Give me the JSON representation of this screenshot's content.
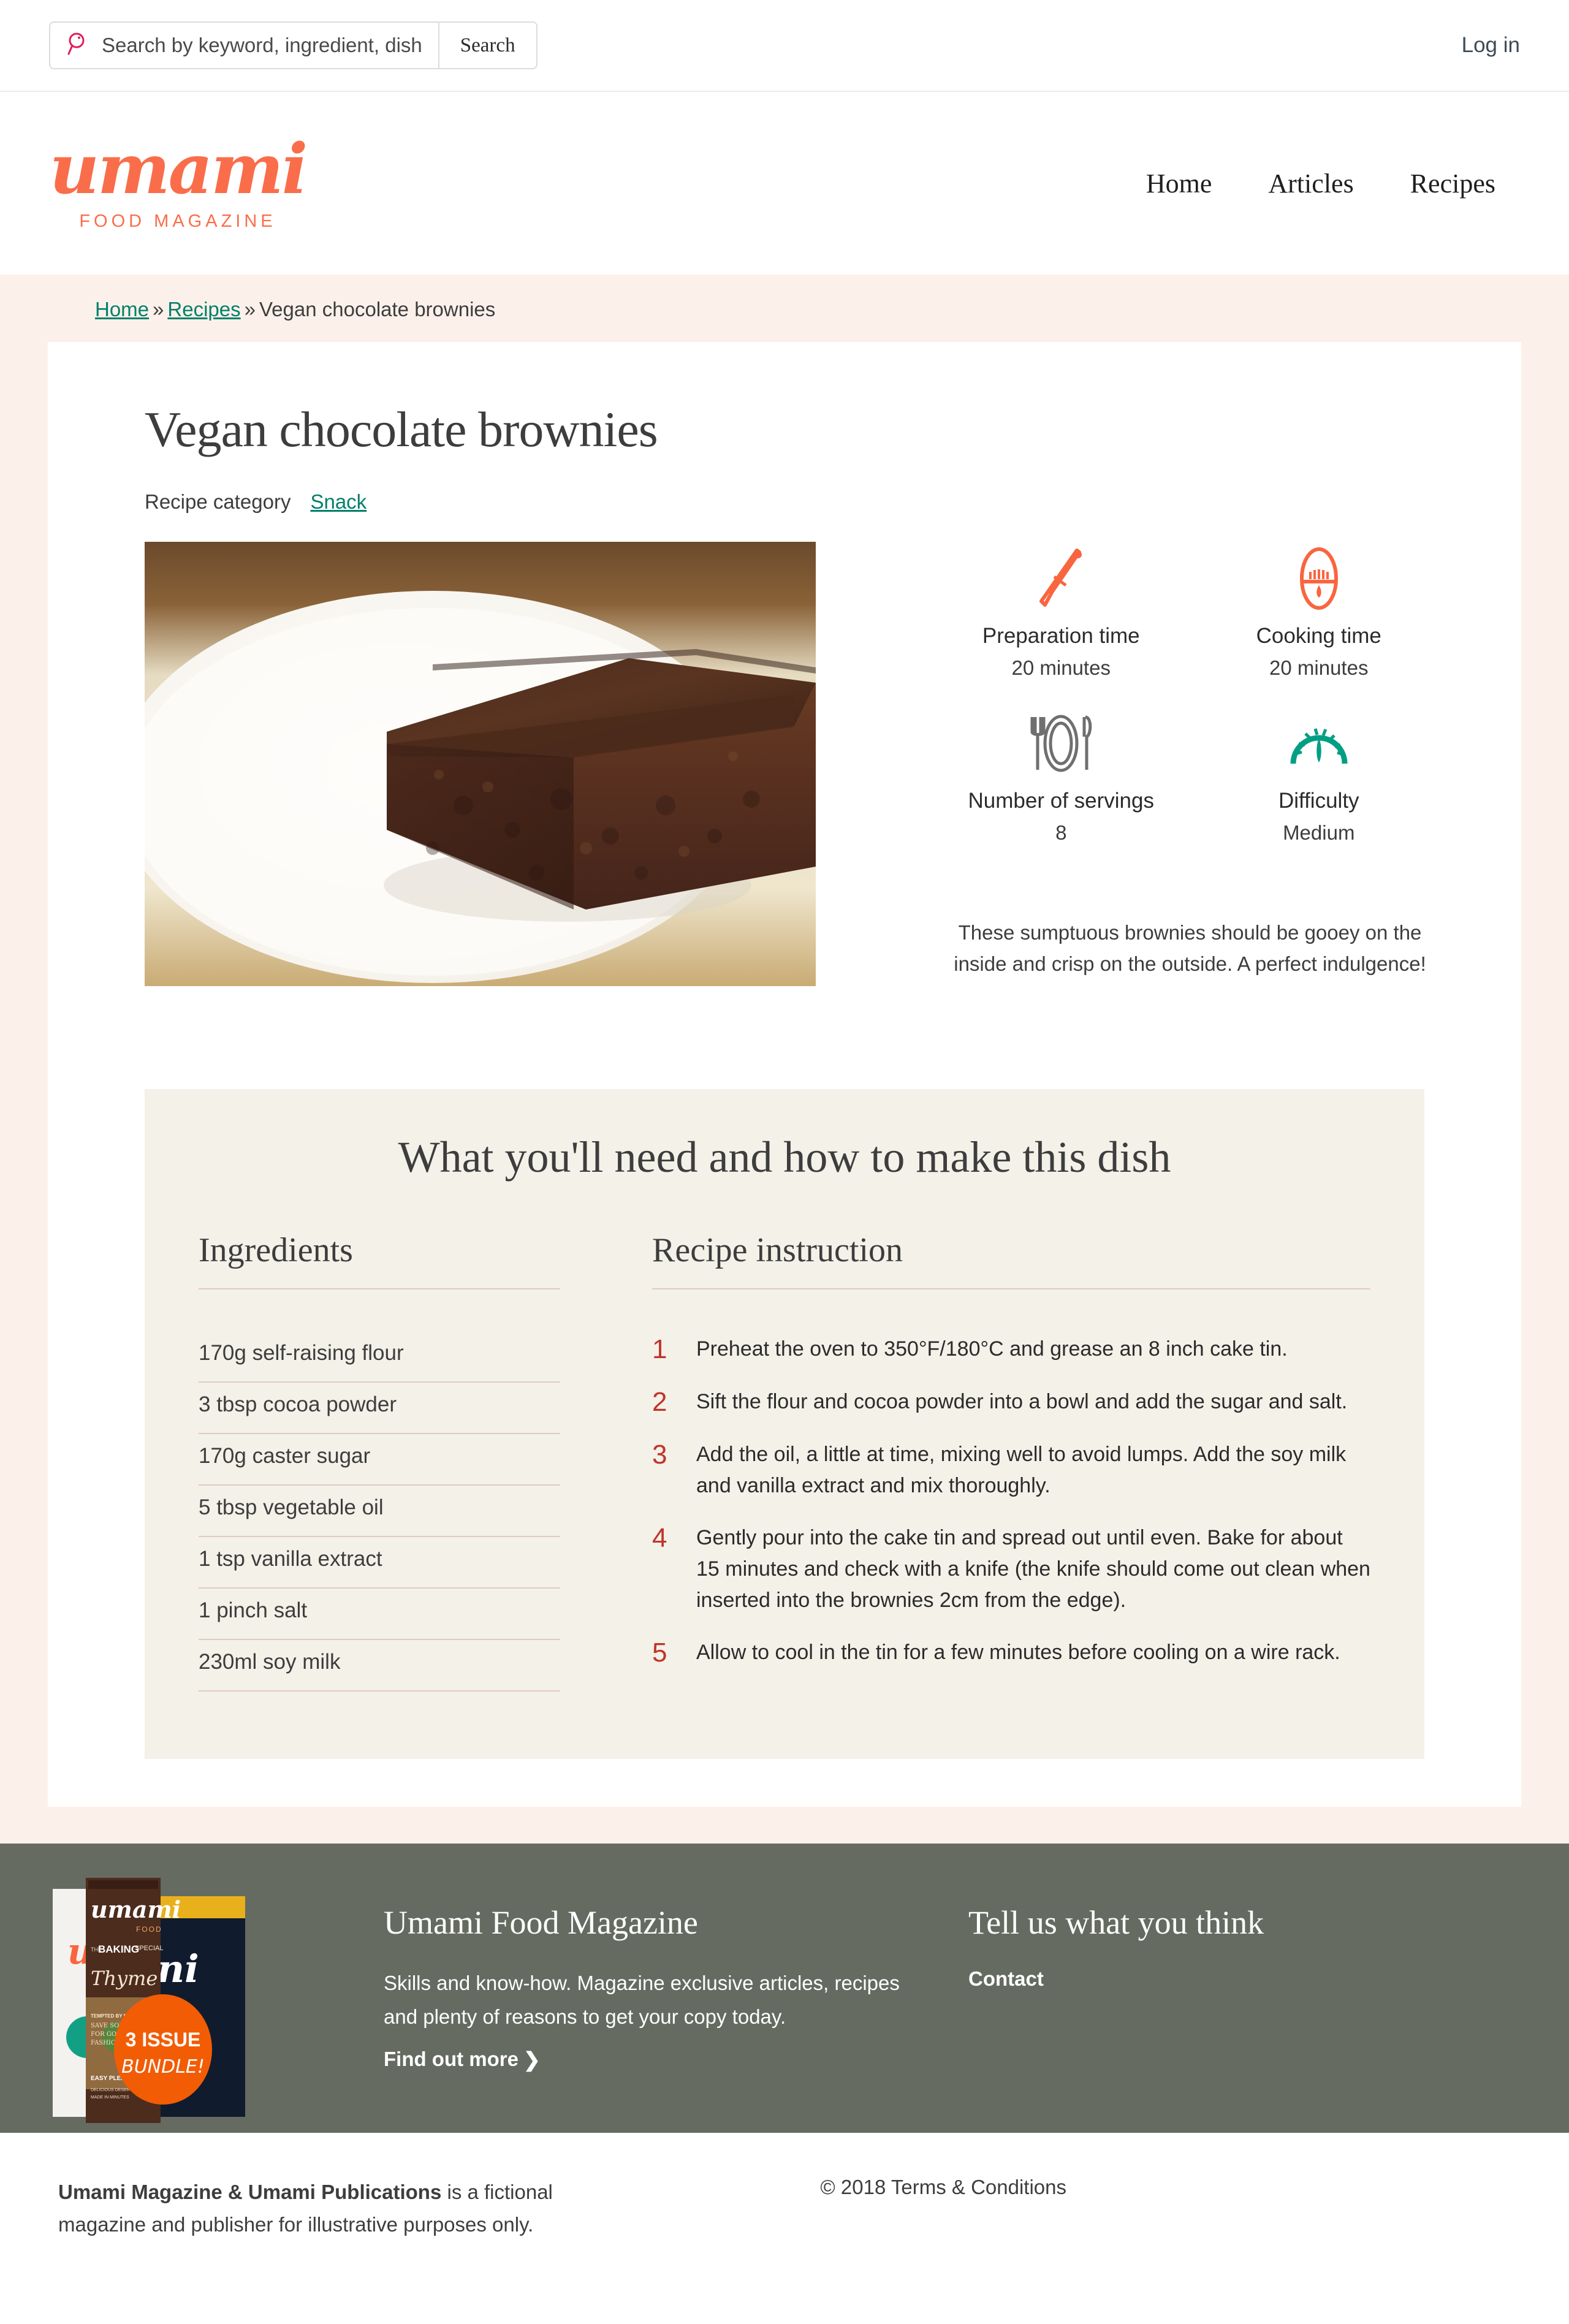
{
  "utility": {
    "search_placeholder": "Search by keyword, ingredient, dish",
    "search_value": "",
    "search_button": "Search",
    "login_label": "Log in"
  },
  "brand": {
    "script": "umami",
    "subtitle": "FOOD MAGAZINE",
    "accent_color": "#fa6d4a"
  },
  "nav": {
    "items": [
      {
        "label": "Home"
      },
      {
        "label": "Articles"
      },
      {
        "label": "Recipes"
      }
    ]
  },
  "breadcrumb": {
    "home": "Home",
    "sep1": "»",
    "recipes": "Recipes",
    "sep2": "»",
    "current": "Vegan chocolate brownies",
    "link_color": "#00806a"
  },
  "recipe": {
    "title": "Vegan chocolate brownies",
    "category_label": "Recipe category",
    "category_value": "Snack",
    "summary": "These sumptuous brownies should be gooey on the inside and crisp on the outside. A perfect indulgence!",
    "facts": [
      {
        "icon": "knife-icon",
        "label": "Preparation time",
        "value": "20 minutes",
        "color": "#f9653f"
      },
      {
        "icon": "oven-timer-icon",
        "label": "Cooking time",
        "value": "20 minutes",
        "color": "#f9653f"
      },
      {
        "icon": "place-setting-icon",
        "label": "Number of servings",
        "value": "8",
        "color": "#6f6f6f"
      },
      {
        "icon": "speedometer-icon",
        "label": "Difficulty",
        "value": "Medium",
        "color": "#009f84"
      }
    ]
  },
  "make": {
    "heading": "What you'll need and how to make this dish",
    "ingredients_heading": "Ingredients",
    "instructions_heading": "Recipe instruction",
    "ingredients": [
      "170g self-raising flour",
      "3 tbsp cocoa powder",
      "170g caster sugar",
      "5 tbsp vegetable oil",
      "1 tsp vanilla extract",
      "1 pinch salt",
      "230ml soy milk"
    ],
    "steps": [
      {
        "num": "1",
        "text": "Preheat the oven to 350°F/180°C and grease an 8 inch cake tin."
      },
      {
        "num": "2",
        "text": "Sift the flour and cocoa powder into a bowl and add the sugar and salt."
      },
      {
        "num": "3",
        "text": "Add the oil, a little at time, mixing well to avoid lumps. Add the soy milk and vanilla extract and mix thoroughly."
      },
      {
        "num": "4",
        "text": "Gently pour into the cake tin and spread out until even. Bake for about 15 minutes and check with a knife (the knife should come out clean when inserted into the brownies 2cm from the edge)."
      },
      {
        "num": "5",
        "text": "Allow to cool in the tin for a few minutes before cooling on a wire rack."
      }
    ],
    "step_number_color": "#c1342a"
  },
  "promo": {
    "title": "Umami Food Magazine",
    "description": "Skills and know-how. Magazine exclusive articles, recipes and plenty of reasons to get your copy today.",
    "cta": "Find out more",
    "cta_chevron": "❯",
    "badge_line1": "3 ISSUE",
    "badge_line2": "BUNDLE!",
    "cover_brand": "umami",
    "cover_food": "FOOD",
    "cover_baking_the": "THE",
    "cover_baking": "BAKING",
    "cover_special": "SPECIAL",
    "cover_thyme": "Thyme",
    "cover_tempted": "TEMPTED BY NOSTALGIA",
    "cover_save": "SAVE SOME ROOM",
    "cover_save2": "FOR GOOD OLD",
    "cover_save3": "FASHIONED PUDS",
    "cover_easy": "EASY PLEASEY",
    "cover_easy2": "DELICIOUS DESERTS",
    "cover_easy3": "MADE IN MINUTES",
    "background": "#656b60"
  },
  "feedback": {
    "title": "Tell us what you think",
    "contact": "Contact"
  },
  "colophon": {
    "strong": "Umami Magazine & Umami Publications",
    "rest": " is a fictional magazine and publisher for illustrative purposes only.",
    "copyright": "© 2018 Terms & Conditions"
  }
}
